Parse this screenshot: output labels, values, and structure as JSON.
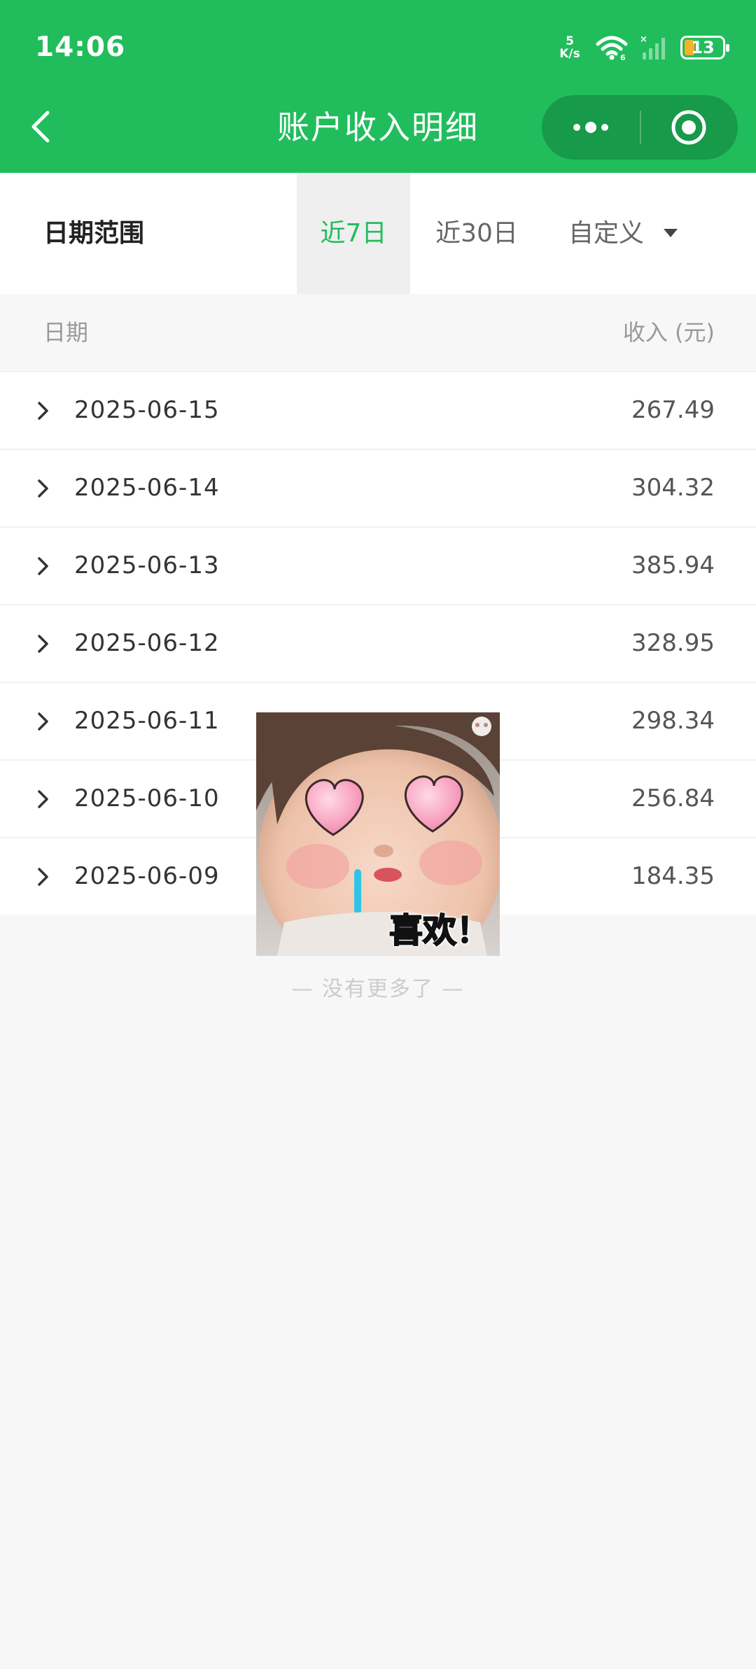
{
  "status_bar": {
    "time": "14:06",
    "net_speed_value": "5",
    "net_speed_unit": "K/s",
    "battery": "13",
    "icons": [
      "wifi-icon",
      "signal-icon"
    ]
  },
  "nav": {
    "title": "账户收入明细",
    "back_icon": "back-icon",
    "more_icon": "more-dots-icon",
    "close_icon": "target-circle-icon"
  },
  "filter": {
    "label": "日期范围",
    "options": [
      {
        "label": "近7日",
        "active": true
      },
      {
        "label": "近30日",
        "active": false
      },
      {
        "label": "自定义",
        "active": false
      }
    ]
  },
  "table": {
    "headers": {
      "date": "日期",
      "amount": "收入 (元)"
    },
    "rows": [
      {
        "date": "2025-06-15",
        "amount": "267.49"
      },
      {
        "date": "2025-06-14",
        "amount": "304.32"
      },
      {
        "date": "2025-06-13",
        "amount": "385.94"
      },
      {
        "date": "2025-06-12",
        "amount": "328.95"
      },
      {
        "date": "2025-06-11",
        "amount": "298.34"
      },
      {
        "date": "2025-06-10",
        "amount": "256.84"
      },
      {
        "date": "2025-06-09",
        "amount": "184.35"
      }
    ],
    "footer": "— 没有更多了 —"
  },
  "sticker": {
    "caption": "喜欢！"
  },
  "colors": {
    "brand_green": "#21bd5c",
    "capsule_green": "#179a49",
    "battery_orange": "#f6b12b"
  }
}
